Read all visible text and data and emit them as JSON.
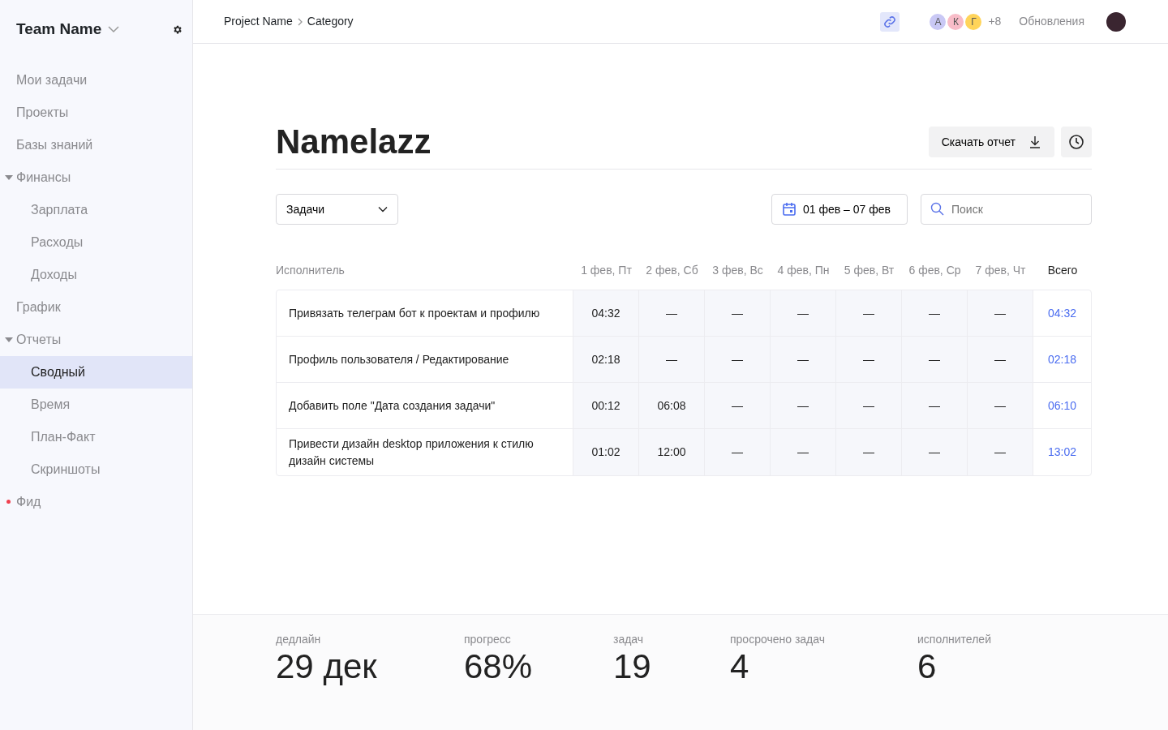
{
  "sidebar": {
    "team": "Team Name",
    "items": [
      {
        "label": "Мои задачи",
        "selected": false
      },
      {
        "label": "Проекты",
        "selected": false
      },
      {
        "label": "Базы знаний",
        "selected": false
      },
      {
        "label": "Финансы",
        "selected": false,
        "expanded": true,
        "children": [
          {
            "label": "Зарплата",
            "selected": false
          },
          {
            "label": "Расходы",
            "selected": false
          },
          {
            "label": "Доходы",
            "selected": false
          }
        ]
      },
      {
        "label": "График",
        "selected": false
      },
      {
        "label": "Отчеты",
        "selected": false,
        "expanded": true,
        "children": [
          {
            "label": "Сводный",
            "selected": true
          },
          {
            "label": "Время",
            "selected": false
          },
          {
            "label": "План-Факт",
            "selected": false
          },
          {
            "label": "Скриншоты",
            "selected": false
          }
        ]
      },
      {
        "label": "Фид",
        "selected": false,
        "unread": true
      }
    ]
  },
  "topbar": {
    "breadcrumbs": [
      "Project Name",
      "Category"
    ],
    "avatars": [
      {
        "letter": "А",
        "color": "#c9c8f5"
      },
      {
        "letter": "К",
        "color": "#f8bcc8"
      },
      {
        "letter": "Г",
        "color": "#ffd45a"
      }
    ],
    "more": "+8",
    "updates": "Обновления"
  },
  "page": {
    "title": "Namelazz",
    "download": "Скачать отчет",
    "group_by": "Задачи",
    "date_range": "01 фев – 07 фев",
    "search": {
      "placeholder": "Поиск"
    }
  },
  "table": {
    "columns": [
      "Исполнитель",
      "1 фев, Пт",
      "2 фев, Сб",
      "3 фев, Вс",
      "4 фев, Пн",
      "5 фев, Вт",
      "6 фев, Ср",
      "7 фев, Чт",
      "Всего"
    ],
    "rows": [
      {
        "task": "Привязать телеграм бот к проектам и профилю",
        "days": [
          "04:32",
          "—",
          "—",
          "—",
          "—",
          "—",
          "—"
        ],
        "total": "04:32"
      },
      {
        "task": "Профиль пользователя / Редактирование",
        "days": [
          "02:18",
          "—",
          "—",
          "—",
          "—",
          "—",
          "—"
        ],
        "total": "02:18"
      },
      {
        "task": "Добавить поле \"Дата создания задачи\"",
        "days": [
          "00:12",
          "06:08",
          "—",
          "—",
          "—",
          "—",
          "—"
        ],
        "total": "06:10"
      },
      {
        "task": "Привести дизайн desktop приложения к стилю дизайн системы",
        "days": [
          "01:02",
          "12:00",
          "—",
          "—",
          "—",
          "—",
          "—"
        ],
        "total": "13:02"
      }
    ]
  },
  "stats": [
    {
      "label": "дедлайн",
      "value": "29 дек"
    },
    {
      "label": "прогресс",
      "value": "68%"
    },
    {
      "label": "задач",
      "value": "19"
    },
    {
      "label": "просрочено задач",
      "value": "4"
    },
    {
      "label": "исполнителей",
      "value": "6"
    }
  ]
}
